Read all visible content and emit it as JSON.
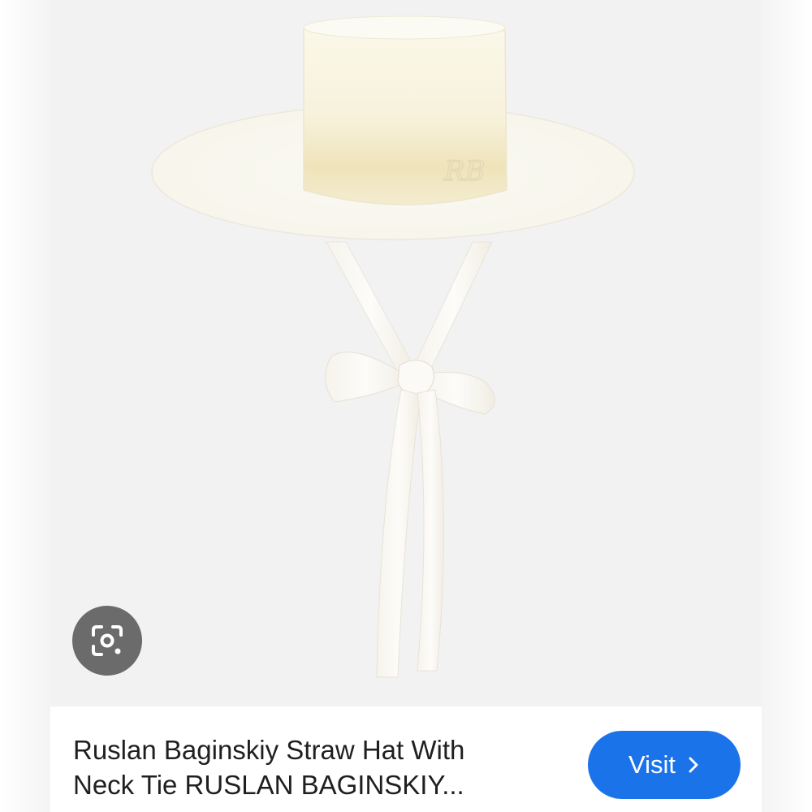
{
  "product": {
    "title": "Ruslan Baginskiy Straw Hat With\nNeck Tie RUSLAN BAGINSKIY...",
    "image_alt": "White straw hat with wide brim, RB monogram and ribbon neck tie"
  },
  "actions": {
    "visit_label": "Visit",
    "visit_icon": "chevron-right-icon",
    "lens_icon": "google-lens-icon"
  },
  "colors": {
    "visit_button": "#1a73e8",
    "lens_button": "#6b6b6b",
    "title_text": "#1f1f1f",
    "background": "#f3f3f3"
  }
}
